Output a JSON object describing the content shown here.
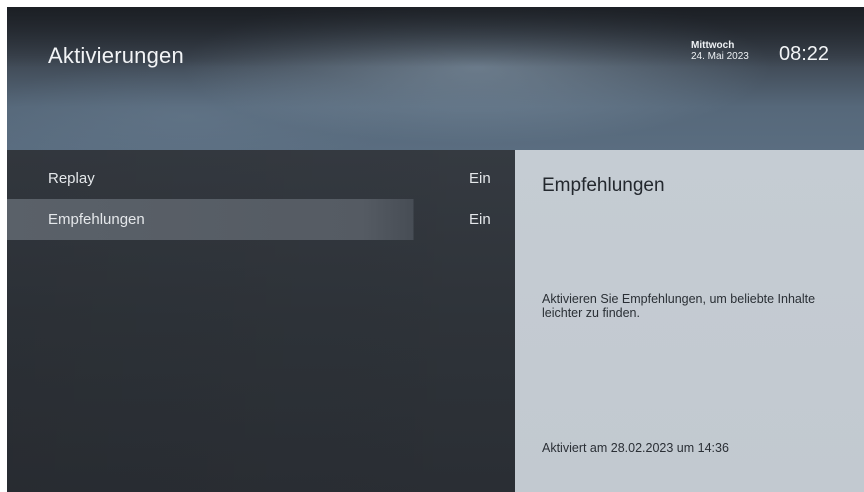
{
  "header": {
    "title": "Aktivierungen",
    "weekday": "Mittwoch",
    "date": "24. Mai 2023",
    "time": "08:22"
  },
  "menu": {
    "items": [
      {
        "label": "Replay",
        "value": "Ein",
        "selected": false
      },
      {
        "label": "Empfehlungen",
        "value": "Ein",
        "selected": true
      }
    ]
  },
  "detail": {
    "title": "Empfehlungen",
    "description": "Aktivieren Sie Empfehlungen, um beliebte Inhalte leichter zu finden.",
    "status": "Aktiviert am 28.02.2023 um 14:36"
  }
}
